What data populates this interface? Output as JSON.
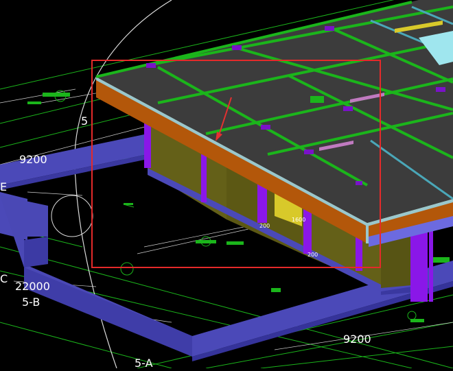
{
  "viewport": {
    "name": "CAD 3D Model Viewport",
    "background": "#000000"
  },
  "labels": {
    "dim_9200_top": "9200",
    "axis_c": "C",
    "dim_22000": "22000",
    "axis_5b": "5-B",
    "dim_9200_bottom": "9200",
    "axis_5a": "5-A",
    "dim_5_top": "5",
    "dim_200_a": "200",
    "dim_200_b": "200",
    "dim_1600": "1600",
    "mark_e": "E"
  },
  "colors": {
    "grid_line": "#1bb51b",
    "slab_top": "#3c3c3c",
    "slab_edge": "#b3570a",
    "beam_blue": "#4b49b8",
    "beam_blue_dark": "#3a38a0",
    "wall_olive": "#646018",
    "column_purple": "#8a17e8",
    "highlight_box": "#e52a2a",
    "arrow": "#e53030",
    "cyan_patch": "#9fe6ee",
    "yellow_strip": "#d8c92a"
  }
}
